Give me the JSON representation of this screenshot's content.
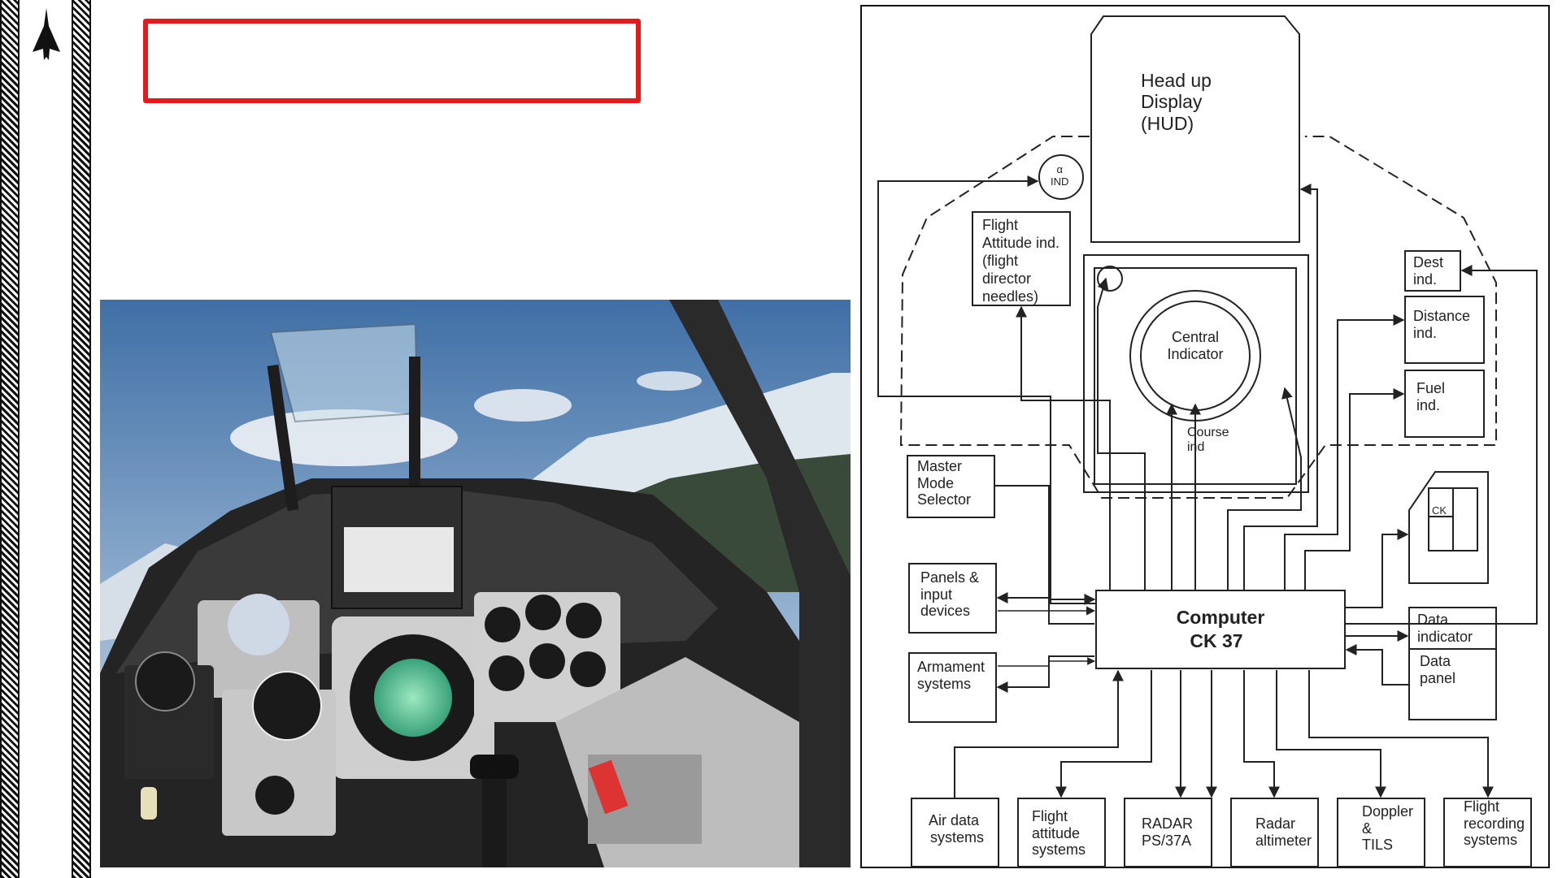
{
  "slide": {
    "title_box_text": ""
  },
  "diagram": {
    "hud": [
      "Head up",
      "Display",
      "(HUD)"
    ],
    "alpha_ind": [
      "α",
      "IND"
    ],
    "flight_attitude_ind": [
      "Flight",
      "Attitude ind.",
      "(flight",
      "director",
      "needles)"
    ],
    "central_indicator": [
      "Central",
      "Indicator"
    ],
    "course_ind": [
      "Course",
      "ind"
    ],
    "dest_ind": [
      "Dest",
      "ind."
    ],
    "distance_ind": [
      "Distance",
      "ind."
    ],
    "fuel_ind": [
      "Fuel",
      "ind."
    ],
    "master_mode_selector": [
      "Master",
      "Mode",
      "Selector"
    ],
    "ck_label": "CK",
    "panels_input": [
      "Panels &",
      "input",
      "devices"
    ],
    "armament": [
      "Armament",
      "systems"
    ],
    "computer": [
      "Computer",
      "CK 37"
    ],
    "data_indicator": [
      "Data",
      "indicator"
    ],
    "data_panel": [
      "Data",
      "panel"
    ],
    "air_data": [
      "Air data",
      "systems"
    ],
    "flight_attitude_sys": [
      "Flight",
      "attitude",
      "systems"
    ],
    "radar": [
      "RADAR",
      "PS/37A"
    ],
    "radar_altimeter": [
      "Radar",
      "altimeter"
    ],
    "doppler": [
      "Doppler",
      "&",
      "TILS"
    ],
    "flight_recording": [
      "Flight",
      "recording",
      "systems"
    ]
  },
  "colors": {
    "accent_red": "#e41b1b",
    "ink": "#222222"
  },
  "icons": {
    "logo": "viggen-aircraft-silhouette-icon",
    "cockpit_photo": "cockpit-photo"
  }
}
